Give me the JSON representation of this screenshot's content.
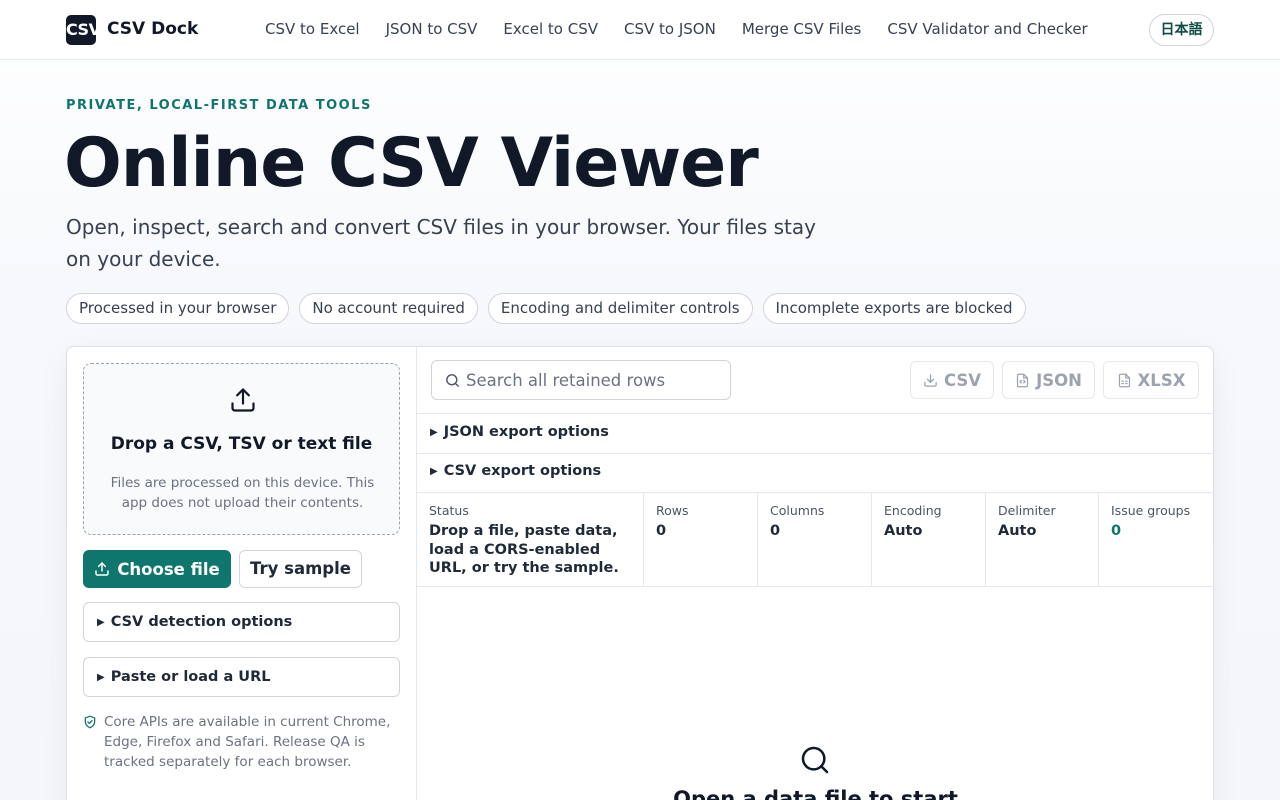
{
  "header": {
    "logo_text": "CSV",
    "brand": "CSV Dock",
    "nav": [
      "CSV to Excel",
      "JSON to CSV",
      "Excel to CSV",
      "CSV to JSON",
      "Merge CSV Files",
      "CSV Validator and Checker"
    ],
    "language": "日本語"
  },
  "hero": {
    "eyebrow": "PRIVATE, LOCAL-FIRST DATA TOOLS",
    "title": "Online CSV Viewer",
    "subtitle": "Open, inspect, search and convert CSV files in your browser. Your files stay on your device.",
    "pills": [
      "Processed in your browser",
      "No account required",
      "Encoding and delimiter controls",
      "Incomplete exports are blocked"
    ]
  },
  "upload": {
    "icon": "upload-icon",
    "title": "Drop a CSV, TSV or text file",
    "note": "Files are processed on this device. This app does not upload their contents.",
    "choose_label": "Choose file",
    "sample_label": "Try sample",
    "detection_label": "CSV detection options",
    "paste_label": "Paste or load a URL",
    "compat_note": "Core APIs are available in current Chrome, Edge, Firefox and Safari. Release QA is tracked separately for each browser."
  },
  "toolbar": {
    "search_placeholder": "Search all retained rows",
    "export_csv": "CSV",
    "export_json": "JSON",
    "export_xlsx": "XLSX"
  },
  "options": {
    "json_label": "JSON export options",
    "csv_label": "CSV export options"
  },
  "stats": {
    "status_label": "Status",
    "status_value": "Drop a file, paste data, load a CORS-enabled URL, or try the sample.",
    "rows_label": "Rows",
    "rows_value": "0",
    "columns_label": "Columns",
    "columns_value": "0",
    "encoding_label": "Encoding",
    "encoding_value": "Auto",
    "delimiter_label": "Delimiter",
    "delimiter_value": "Auto",
    "issues_label": "Issue groups",
    "issues_value": "0"
  },
  "empty": {
    "title": "Open a data file to start"
  },
  "colors": {
    "accent": "#0f766e",
    "ink": "#111827"
  }
}
